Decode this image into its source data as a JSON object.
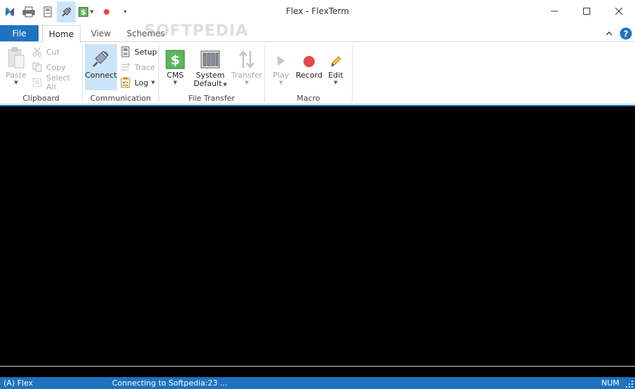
{
  "window": {
    "title": "Flex - FlexTerm"
  },
  "tabs": {
    "file": "File",
    "home": "Home",
    "view": "View",
    "schemes": "Schemes"
  },
  "ribbon": {
    "clipboard": {
      "label": "Clipboard",
      "paste": "Paste",
      "cut": "Cut",
      "copy": "Copy",
      "select_all": "Select All"
    },
    "communication": {
      "label": "Communication",
      "connect": "Connect",
      "setup": "Setup",
      "trace": "Trace",
      "log": "Log"
    },
    "file_transfer": {
      "label": "File Transfer",
      "cms": "CMS",
      "system_default_1": "System",
      "system_default_2": "Default",
      "transfer": "Transfer"
    },
    "macro": {
      "label": "Macro",
      "play": "Play",
      "record": "Record",
      "edit": "Edit"
    }
  },
  "watermark": "SOFTPEDIA",
  "status": {
    "session": "(A) Flex",
    "message": "Connecting to Softpedia:23 ...",
    "num": "NUM"
  },
  "colors": {
    "accent": "#1e73be",
    "active_button": "#cce4f7",
    "terminal_bg": "#000000",
    "record": "#e8474c",
    "cms_green": "#4caf50"
  }
}
